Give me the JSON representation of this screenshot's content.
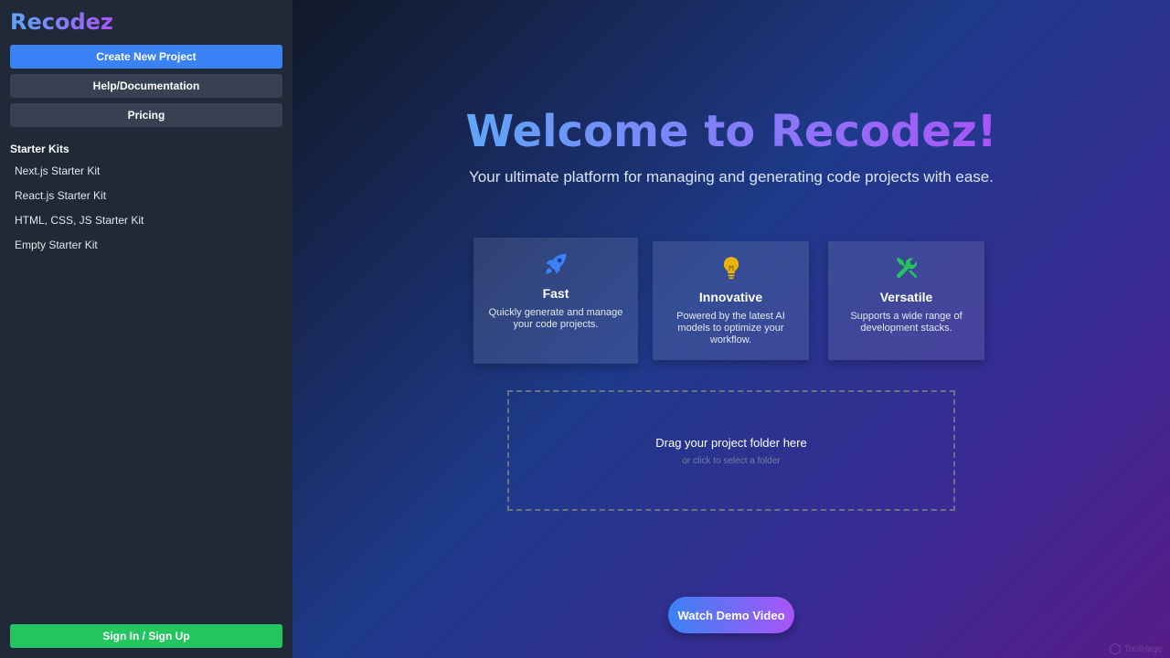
{
  "sidebar": {
    "logo": "Recodez",
    "buttons": {
      "create": "Create New Project",
      "help": "Help/Documentation",
      "pricing": "Pricing"
    },
    "starter_heading": "Starter Kits",
    "starter_kits": [
      "Next.js Starter Kit",
      "React.js Starter Kit",
      "HTML, CSS, JS Starter Kit",
      "Empty Starter Kit"
    ],
    "signin": "Sign In / Sign Up"
  },
  "main": {
    "title": "Welcome to Recodez!",
    "subtitle": "Your ultimate platform for managing and generating code projects with ease.",
    "cards": [
      {
        "icon": "rocket-icon",
        "title": "Fast",
        "desc": "Quickly generate and manage your code projects."
      },
      {
        "icon": "lightbulb-icon",
        "title": "Innovative",
        "desc": "Powered by the latest AI models to optimize your workflow."
      },
      {
        "icon": "tools-icon",
        "title": "Versatile",
        "desc": "Supports a wide range of development stacks."
      }
    ],
    "dropzone": {
      "title": "Drag your project folder here",
      "subtitle": "or click to select a folder"
    },
    "demo_button": "Watch Demo Video"
  },
  "watermark": "ToolHage",
  "colors": {
    "sidebar_bg": "#1f2937",
    "primary": "#3b82f6",
    "secondary": "#374151",
    "success": "#22c55e",
    "gradient_start": "#60a5fa",
    "gradient_end": "#a855f7",
    "rocket": "#3b82f6",
    "lightbulb": "#eab308",
    "tools": "#22c55e"
  }
}
